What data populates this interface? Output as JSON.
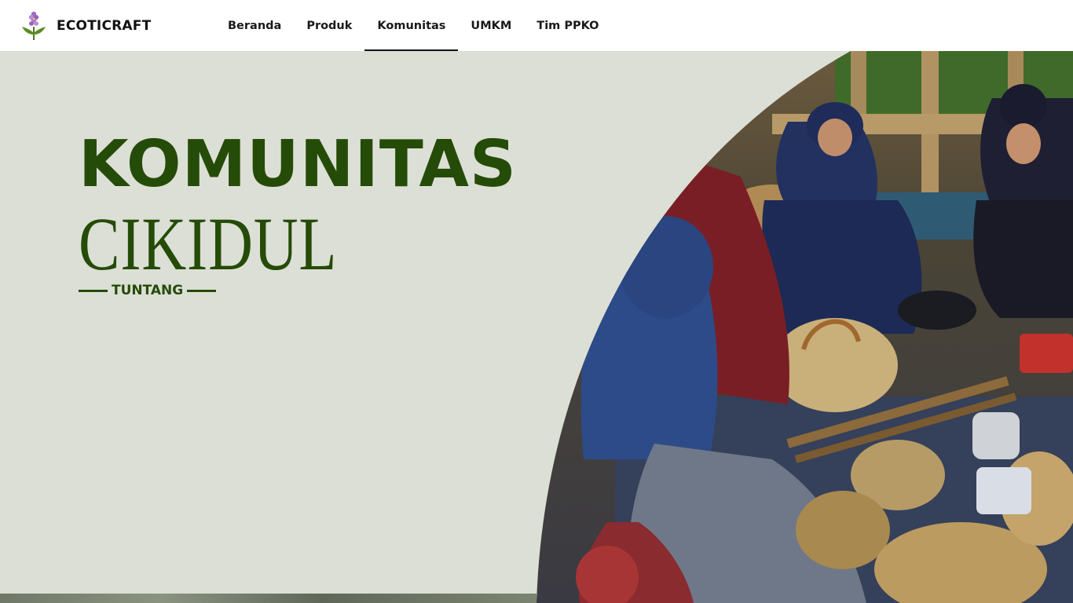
{
  "brand": {
    "name": "ECOTICRAFT",
    "logo_icon": "water-hyacinth-flower-icon",
    "accent_color": "#254b08"
  },
  "nav": {
    "items": [
      {
        "label": "Beranda",
        "active": false
      },
      {
        "label": "Produk",
        "active": false
      },
      {
        "label": "Komunitas",
        "active": true
      },
      {
        "label": "UMKM",
        "active": false
      },
      {
        "label": "Tim PPKO",
        "active": false
      }
    ]
  },
  "hero": {
    "title": "KOMUNITAS",
    "subtitle": "CIKIDUL",
    "tag": "TUNTANG",
    "background_color": "#dcdfd6",
    "image": "photo-women-weaving-water-hyacinth-baskets"
  }
}
